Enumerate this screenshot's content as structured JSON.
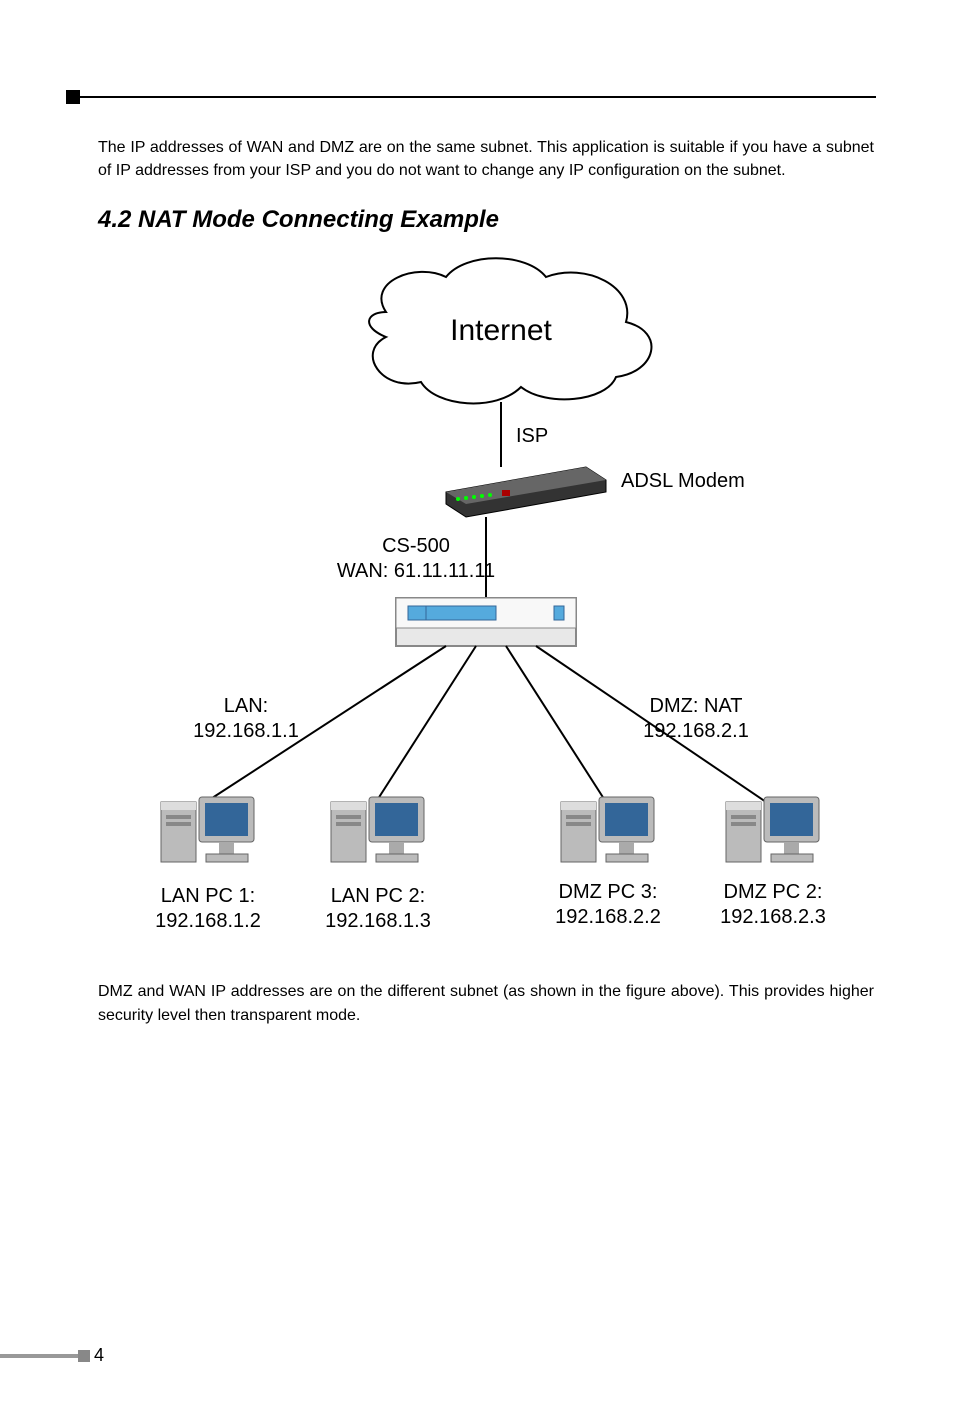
{
  "intro_paragraph": "The IP addresses of WAN and DMZ are on the same subnet. This application is suitable if you have a subnet of IP addresses from your ISP and you do not want to change any IP configuration on the subnet.",
  "section_heading": "4.2 NAT Mode Connecting Example",
  "diagram": {
    "cloud_label": "Internet",
    "isp_label": "ISP",
    "modem_label": "ADSL Modem",
    "router_line1": "CS-500",
    "router_line2": "WAN: 61.11.11.11",
    "lan_label_line1": "LAN:",
    "lan_label_line2": "192.168.1.1",
    "dmz_label_line1": "DMZ: NAT",
    "dmz_label_line2": "192.168.2.1",
    "pc1_line1": "LAN PC 1:",
    "pc1_line2": "192.168.1.2",
    "pc2_line1": "LAN PC 2:",
    "pc2_line2": "192.168.1.3",
    "pc3_line1": "DMZ PC 3:",
    "pc3_line2": "192.168.2.2",
    "pc4_line1": "DMZ PC 2:",
    "pc4_line2": "192.168.2.3"
  },
  "closing_paragraph": "DMZ and WAN IP addresses are on the different subnet (as shown in the figure above). This provides higher security level then transparent mode.",
  "page_number": "4"
}
